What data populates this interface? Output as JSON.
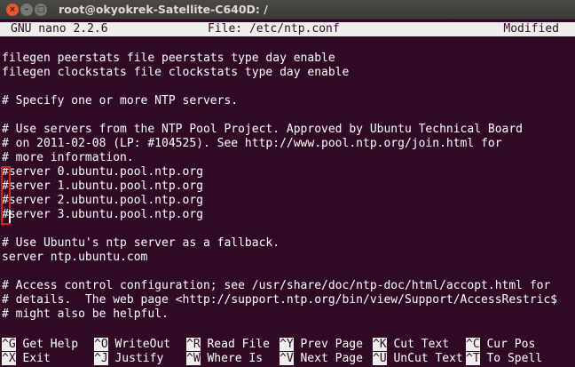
{
  "window": {
    "title": "root@okyokrek-Satellite-C640D: /",
    "close_glyph": "×",
    "min_glyph": "–",
    "max_glyph": "□"
  },
  "nano": {
    "version": "GNU nano 2.2.6",
    "file": "File: /etc/ntp.conf",
    "status": "Modified"
  },
  "lines": [
    "filegen peerstats file peerstats type day enable",
    "filegen clockstats file clockstats type day enable",
    "",
    "# Specify one or more NTP servers.",
    "",
    "# Use servers from the NTP Pool Project. Approved by Ubuntu Technical Board",
    "# on 2011-02-08 (LP: #104525). See http://www.pool.ntp.org/join.html for",
    "# more information.",
    "#server 0.ubuntu.pool.ntp.org",
    "#server 1.ubuntu.pool.ntp.org",
    "#server 2.ubuntu.pool.ntp.org",
    "#server 3.ubuntu.pool.ntp.org",
    "",
    "# Use Ubuntu's ntp server as a fallback.",
    "server ntp.ubuntu.com",
    "",
    "# Access control configuration; see /usr/share/doc/ntp-doc/html/accopt.html for",
    "# details.  The web page <http://support.ntp.org/bin/view/Support/AccessRestric$",
    "# might also be helpful."
  ],
  "shortcuts": [
    {
      "key": "^G",
      "label": "Get Help"
    },
    {
      "key": "^O",
      "label": "WriteOut"
    },
    {
      "key": "^R",
      "label": "Read File"
    },
    {
      "key": "^Y",
      "label": "Prev Page"
    },
    {
      "key": "^K",
      "label": "Cut Text"
    },
    {
      "key": "^C",
      "label": "Cur Pos"
    },
    {
      "key": "^X",
      "label": "Exit"
    },
    {
      "key": "^J",
      "label": "Justify"
    },
    {
      "key": "^W",
      "label": "Where Is"
    },
    {
      "key": "^V",
      "label": "Next Page"
    },
    {
      "key": "^U",
      "label": "UnCut Text"
    },
    {
      "key": "^T",
      "label": "To Spell"
    }
  ],
  "colors": {
    "terminal_bg": "#300a24",
    "text": "#ffffff",
    "highlight_box": "#e01b1b"
  }
}
